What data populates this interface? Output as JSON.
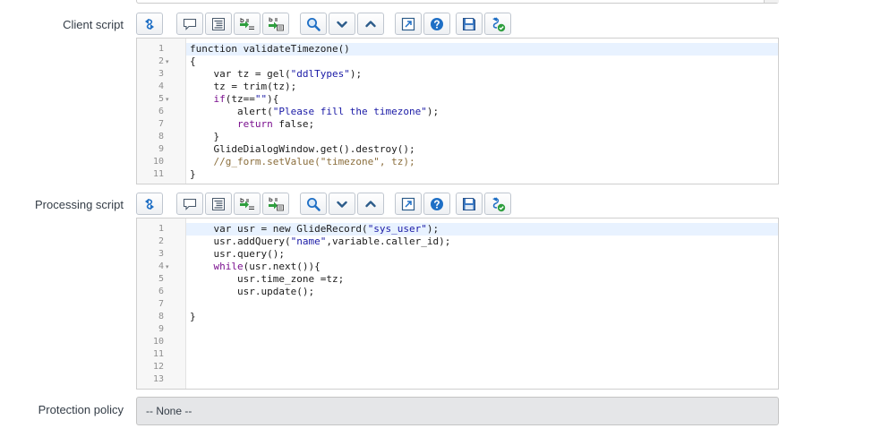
{
  "client_script": {
    "label": "Client script",
    "lines": [
      {
        "n": "1",
        "fold": false,
        "tokens": [
          {
            "t": "function validateTimezone()",
            "c": ""
          }
        ]
      },
      {
        "n": "2",
        "fold": true,
        "tokens": [
          {
            "t": "{",
            "c": ""
          }
        ]
      },
      {
        "n": "3",
        "fold": false,
        "tokens": [
          {
            "t": "    var tz = gel(",
            "c": ""
          },
          {
            "t": "\"ddlTypes\"",
            "c": "str"
          },
          {
            "t": ");",
            "c": ""
          }
        ]
      },
      {
        "n": "4",
        "fold": false,
        "tokens": [
          {
            "t": "    tz = trim(tz);",
            "c": ""
          }
        ]
      },
      {
        "n": "5",
        "fold": true,
        "tokens": [
          {
            "t": "    ",
            "c": ""
          },
          {
            "t": "if",
            "c": "kw"
          },
          {
            "t": "(tz==",
            "c": ""
          },
          {
            "t": "\"\"",
            "c": "str"
          },
          {
            "t": "){",
            "c": ""
          }
        ]
      },
      {
        "n": "6",
        "fold": false,
        "tokens": [
          {
            "t": "        alert(",
            "c": ""
          },
          {
            "t": "\"Please fill the timezone\"",
            "c": "str"
          },
          {
            "t": ");",
            "c": ""
          }
        ]
      },
      {
        "n": "7",
        "fold": false,
        "tokens": [
          {
            "t": "        ",
            "c": ""
          },
          {
            "t": "return",
            "c": "kw"
          },
          {
            "t": " false;",
            "c": ""
          }
        ]
      },
      {
        "n": "8",
        "fold": false,
        "tokens": [
          {
            "t": "    }",
            "c": ""
          }
        ]
      },
      {
        "n": "9",
        "fold": false,
        "tokens": [
          {
            "t": "    GlideDialogWindow.get().destroy();",
            "c": ""
          }
        ]
      },
      {
        "n": "10",
        "fold": false,
        "tokens": [
          {
            "t": "    //g_form.setValue(\"timezone\", tz);",
            "c": "cm"
          }
        ]
      },
      {
        "n": "11",
        "fold": false,
        "tokens": [
          {
            "t": "}",
            "c": ""
          }
        ]
      }
    ]
  },
  "processing_script": {
    "label": "Processing script",
    "lines": [
      {
        "n": "1",
        "fold": false,
        "tokens": [
          {
            "t": "    var usr = new GlideRecord(",
            "c": ""
          },
          {
            "t": "\"sys_user\"",
            "c": "str"
          },
          {
            "t": ");",
            "c": ""
          }
        ]
      },
      {
        "n": "2",
        "fold": false,
        "tokens": [
          {
            "t": "    usr.addQuery(",
            "c": ""
          },
          {
            "t": "\"name\"",
            "c": "str"
          },
          {
            "t": ",variable.caller_id);",
            "c": ""
          }
        ]
      },
      {
        "n": "3",
        "fold": false,
        "tokens": [
          {
            "t": "    usr.query();",
            "c": ""
          }
        ]
      },
      {
        "n": "4",
        "fold": true,
        "tokens": [
          {
            "t": "    ",
            "c": ""
          },
          {
            "t": "while",
            "c": "kw"
          },
          {
            "t": "(usr.next()){",
            "c": ""
          }
        ]
      },
      {
        "n": "5",
        "fold": false,
        "tokens": [
          {
            "t": "        usr.time_zone =tz;",
            "c": ""
          }
        ]
      },
      {
        "n": "6",
        "fold": false,
        "tokens": [
          {
            "t": "        usr.update();",
            "c": ""
          }
        ]
      },
      {
        "n": "7",
        "fold": false,
        "tokens": []
      },
      {
        "n": "8",
        "fold": false,
        "tokens": [
          {
            "t": "}",
            "c": ""
          }
        ]
      },
      {
        "n": "9",
        "fold": false,
        "tokens": []
      },
      {
        "n": "10",
        "fold": false,
        "tokens": []
      },
      {
        "n": "11",
        "fold": false,
        "tokens": []
      },
      {
        "n": "12",
        "fold": false,
        "tokens": []
      },
      {
        "n": "13",
        "fold": false,
        "tokens": []
      }
    ]
  },
  "protection_policy": {
    "label": "Protection policy",
    "value": "-- None --"
  },
  "toolbar_buttons": [
    {
      "name": "toggle-syntax-editor-button",
      "icon": "syntax-toggle-icon"
    },
    {
      "name": "comment-selected-button",
      "icon": "comment-icon"
    },
    {
      "name": "format-code-button",
      "icon": "format-code-icon"
    },
    {
      "name": "replace-button",
      "icon": "replace-icon"
    },
    {
      "name": "replace-all-button",
      "icon": "replace-all-icon"
    },
    {
      "name": "search-button",
      "icon": "magnifier-icon"
    },
    {
      "name": "find-next-button",
      "icon": "chevron-down-icon"
    },
    {
      "name": "find-previous-button",
      "icon": "chevron-up-icon"
    },
    {
      "name": "fullscreen-button",
      "icon": "expand-icon"
    },
    {
      "name": "help-button",
      "icon": "help-icon"
    },
    {
      "name": "save-button",
      "icon": "floppy-disk-icon"
    },
    {
      "name": "check-syntax-button",
      "icon": "script-check-icon"
    }
  ],
  "colors": {
    "keyword": "#7a0f8e",
    "string": "#1a1aa6",
    "comment": "#8a6d3b",
    "active_line": "#e8f2ff",
    "icon_blue": "#1f6fc5",
    "icon_green": "#2e9e3e"
  }
}
